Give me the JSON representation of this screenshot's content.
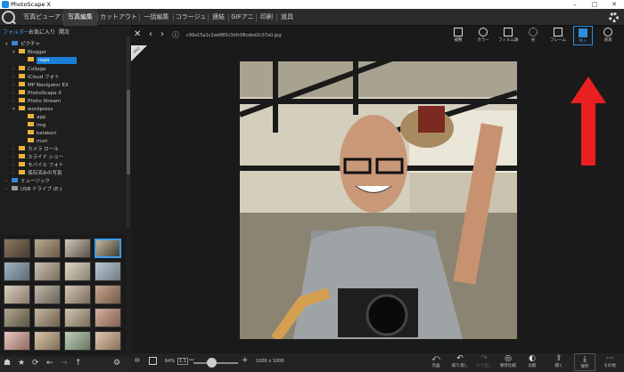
{
  "window": {
    "title": "PhotoScape X",
    "controls": {
      "minimize": "–",
      "maximize": "□",
      "close": "✕"
    }
  },
  "menubar": {
    "tabs": [
      "写真ビューア",
      "写真編集",
      "カットアウト",
      "一括編集",
      "コラージュ",
      "連結",
      "GIFアニメ",
      "印刷",
      "道具"
    ],
    "active_tab": "写真編集"
  },
  "left_panel": {
    "subtabs": [
      "フォルダー",
      "お気に入り",
      "開次"
    ],
    "tree": [
      {
        "label": "ピクチャ",
        "level": 0,
        "icon": "blue-folder"
      },
      {
        "label": "Blogger",
        "level": 1
      },
      {
        "label": "repo",
        "level": 2,
        "selected": true
      },
      {
        "label": "Collage",
        "level": 1
      },
      {
        "label": "iCloud フォト",
        "level": 1
      },
      {
        "label": "MP Navigator EX",
        "level": 1
      },
      {
        "label": "PhotoScape X",
        "level": 1
      },
      {
        "label": "Photo Stream",
        "level": 1
      },
      {
        "label": "wordpress",
        "level": 1
      },
      {
        "label": "app",
        "level": 2
      },
      {
        "label": "img",
        "level": 2
      },
      {
        "label": "katakori",
        "level": 2
      },
      {
        "label": "mori",
        "level": 2
      },
      {
        "label": "カメラ ロール",
        "level": 1
      },
      {
        "label": "スライド ショー",
        "level": 1
      },
      {
        "label": "モバイル フォト",
        "level": 1
      },
      {
        "label": "保存済みの写真",
        "level": 1
      },
      {
        "label": "ミュージック",
        "level": 0,
        "icon": "music-folder"
      },
      {
        "label": "USB ドライブ (E:)",
        "level": 0,
        "icon": "drive"
      }
    ]
  },
  "editor": {
    "filename": "c99a15a1c2ad485c3dfc08cebd2c37a0.jpg",
    "badge": "PRO",
    "tools": [
      {
        "label": "補整",
        "icon": "edit-icon"
      },
      {
        "label": "カラー",
        "icon": "color-icon"
      },
      {
        "label": "フィルム調",
        "icon": "film-icon"
      },
      {
        "label": "光",
        "icon": "light-icon"
      },
      {
        "label": "フレーム",
        "icon": "frame-icon"
      },
      {
        "label": "挿入",
        "icon": "insert-icon",
        "active": true
      },
      {
        "label": "道具",
        "icon": "tools-icon"
      }
    ],
    "accent": "#2d8ee0",
    "arrow_color": "#e8201f"
  },
  "bottom_bar": {
    "zoom_value": "64%",
    "zoom_fit": "1:1",
    "image_size": "1000 x 1000",
    "actions": [
      {
        "label": "元画",
        "icon": "undo-all-icon"
      },
      {
        "label": "取り消し",
        "icon": "undo-icon"
      },
      {
        "label": "やり直し",
        "icon": "redo-icon"
      },
      {
        "label": "保存比較",
        "icon": "compare-icon"
      },
      {
        "label": "比較",
        "icon": "compare2-icon"
      },
      {
        "label": "開く",
        "icon": "open-icon"
      },
      {
        "label": "保存",
        "icon": "save-icon"
      },
      {
        "label": "その他",
        "icon": "more-icon"
      }
    ]
  }
}
